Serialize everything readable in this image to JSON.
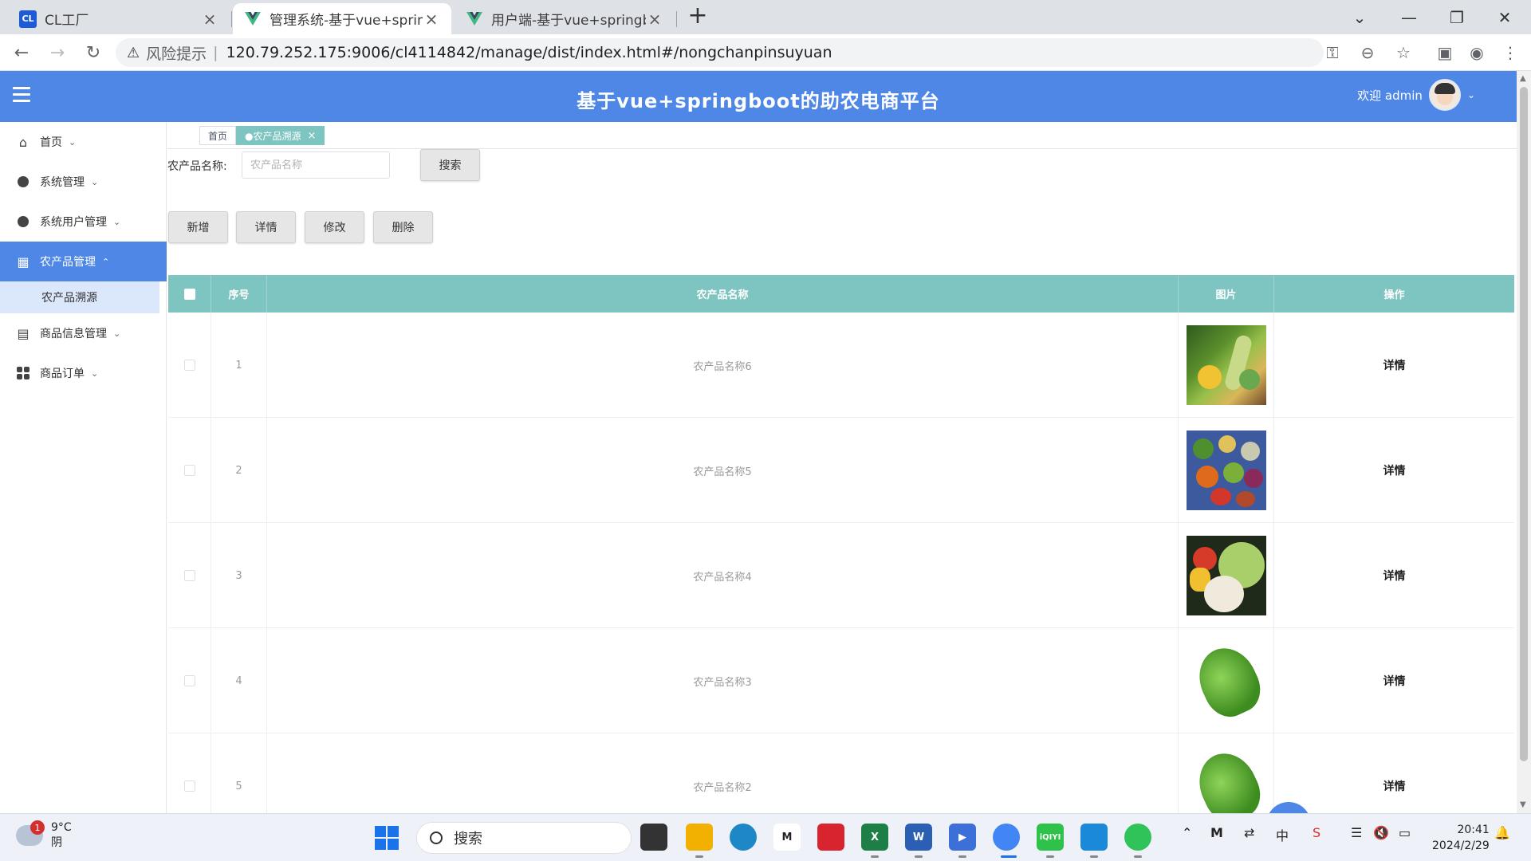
{
  "browser": {
    "tabs": [
      {
        "title": "CL工厂",
        "icon": "cl-logo-icon"
      },
      {
        "title": "管理系统-基于vue+springbo",
        "icon": "vue-logo-icon"
      },
      {
        "title": "用户端-基于vue+springboot",
        "icon": "vue-logo-icon"
      }
    ],
    "address": {
      "warning_label": "风险提示",
      "separator": "|",
      "url": "120.79.252.175:9006/cl4114842/manage/dist/index.html#/nongchanpinsuyuan"
    }
  },
  "app": {
    "title": "基于vue+springboot的助农电商平台",
    "welcome": "欢迎 admin",
    "header_color": "#4e87e6"
  },
  "sidebar": {
    "items": [
      {
        "label": "首页",
        "icon": "home-icon"
      },
      {
        "label": "系统管理",
        "icon": "circle-icon"
      },
      {
        "label": "系统用户管理",
        "icon": "check-circle-icon"
      },
      {
        "label": "农产品管理",
        "icon": "grid-icon",
        "active": true
      },
      {
        "label": "商品信息管理",
        "icon": "stack-icon"
      },
      {
        "label": "商品订单",
        "icon": "apps-icon"
      }
    ],
    "submenu": [
      {
        "label": "农产品溯源"
      }
    ]
  },
  "tags": [
    {
      "label": "首页"
    },
    {
      "label": "●农产品溯源",
      "active": true
    }
  ],
  "search": {
    "label": "农产品名称:",
    "placeholder": "农产品名称",
    "button": "搜索"
  },
  "actions": {
    "add": "新增",
    "detail": "详情",
    "edit": "修改",
    "delete": "删除"
  },
  "table": {
    "header_color": "#7ec4c0",
    "columns": [
      "序号",
      "农产品名称",
      "图片",
      "操作"
    ],
    "rows": [
      {
        "index": "1",
        "name": "农产品名称6",
        "image": "vegetable-assortment-image",
        "action": "详情"
      },
      {
        "index": "2",
        "name": "农产品名称5",
        "image": "colorful-vegetables-image",
        "action": "详情"
      },
      {
        "index": "3",
        "name": "农产品名称4",
        "image": "cauliflower-cabbage-image",
        "action": "详情"
      },
      {
        "index": "4",
        "name": "农产品名称3",
        "image": "lettuce-image",
        "action": "详情"
      },
      {
        "index": "5",
        "name": "农产品名称2",
        "image": "lettuce-image",
        "action": "详情"
      }
    ]
  },
  "taskbar": {
    "weather": {
      "badge": "1",
      "temp": "9°C",
      "condition": "阴"
    },
    "search_label": "搜索",
    "time": "20:41",
    "date": "2024/2/29"
  }
}
